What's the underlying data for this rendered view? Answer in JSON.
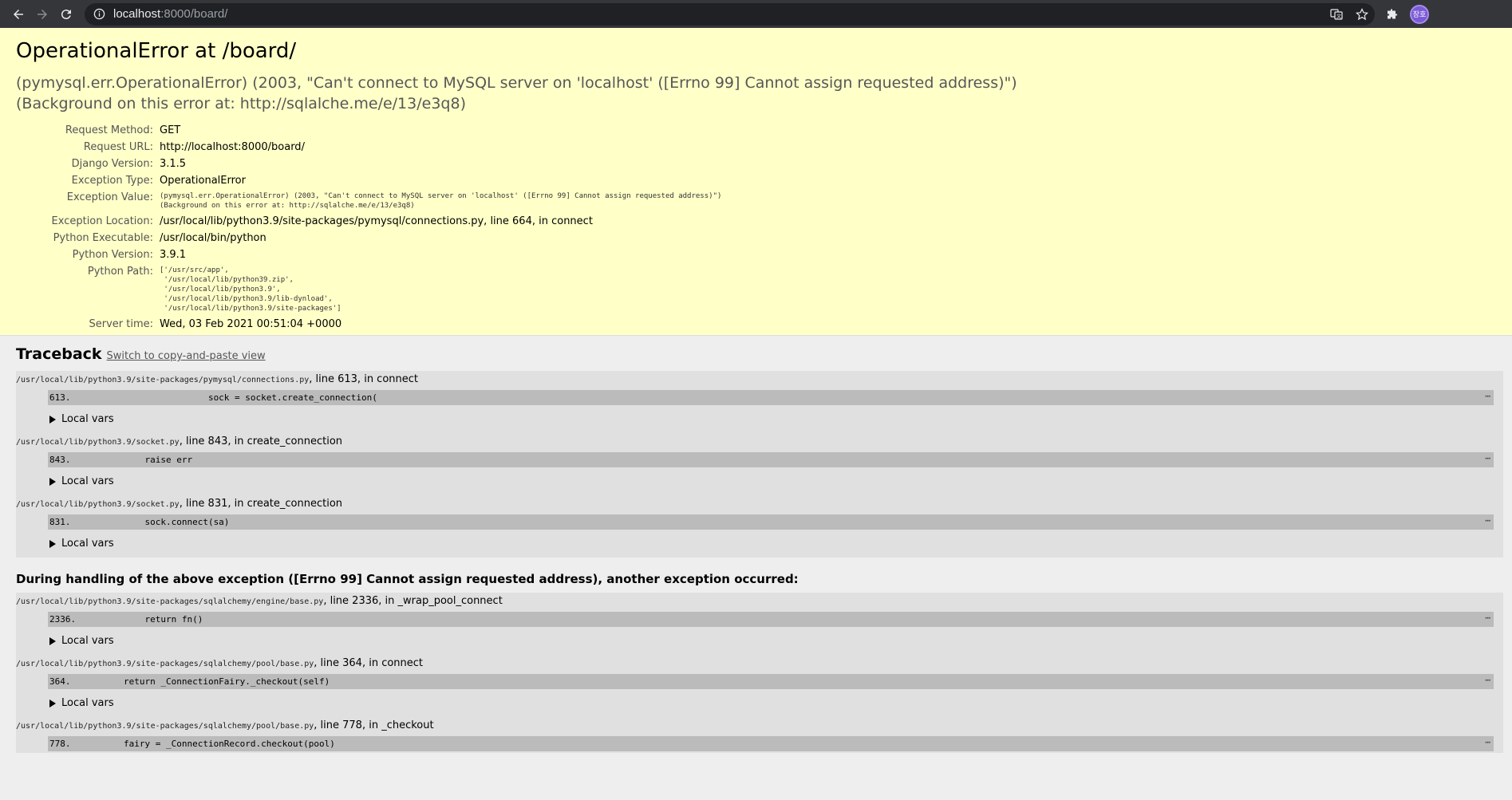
{
  "browser": {
    "url_host": "localhost",
    "url_rest": ":8000/board/",
    "avatar_text": "장호"
  },
  "summary": {
    "title": "OperationalError at /board/",
    "exception_value_line1": "(pymysql.err.OperationalError) (2003, \"Can't connect to MySQL server on 'localhost' ([Errno 99] Cannot assign requested address)\")",
    "exception_value_line2": "(Background on this error at: http://sqlalche.me/e/13/e3q8)",
    "meta": {
      "request_method_label": "Request Method:",
      "request_method": "GET",
      "request_url_label": "Request URL:",
      "request_url": "http://localhost:8000/board/",
      "django_version_label": "Django Version:",
      "django_version": "3.1.5",
      "exception_type_label": "Exception Type:",
      "exception_type": "OperationalError",
      "exception_value_label": "Exception Value:",
      "exception_value_1": "(pymysql.err.OperationalError) (2003, \"Can't connect to MySQL server on 'localhost' ([Errno 99] Cannot assign requested address)\")",
      "exception_value_2": "(Background on this error at: http://sqlalche.me/e/13/e3q8)",
      "exception_location_label": "Exception Location:",
      "exception_location": "/usr/local/lib/python3.9/site-packages/pymysql/connections.py, line 664, in connect",
      "python_executable_label": "Python Executable:",
      "python_executable": "/usr/local/bin/python",
      "python_version_label": "Python Version:",
      "python_version": "3.9.1",
      "python_path_label": "Python Path:",
      "python_path": [
        "['/usr/src/app',",
        " '/usr/local/lib/python39.zip',",
        " '/usr/local/lib/python3.9',",
        " '/usr/local/lib/python3.9/lib-dynload',",
        " '/usr/local/lib/python3.9/site-packages']"
      ],
      "server_time_label": "Server time:",
      "server_time": "Wed, 03 Feb 2021 00:51:04 +0000"
    }
  },
  "traceback": {
    "title": "Traceback",
    "switch_label": "Switch to copy-and-paste view",
    "local_vars_label": "Local vars",
    "group1": [
      {
        "file": "/usr/local/lib/python3.9/site-packages/pymysql/connections.py",
        "where": ", line 613, in connect",
        "lineno": "613.",
        "code": "                        sock = socket.create_connection("
      },
      {
        "file": "/usr/local/lib/python3.9/socket.py",
        "where": ", line 843, in create_connection",
        "lineno": "843.",
        "code": "            raise err"
      },
      {
        "file": "/usr/local/lib/python3.9/socket.py",
        "where": ", line 831, in create_connection",
        "lineno": "831.",
        "code": "            sock.connect(sa)"
      }
    ],
    "during_text": "During handling of the above exception ([Errno 99] Cannot assign requested address), another exception occurred:",
    "group2": [
      {
        "file": "/usr/local/lib/python3.9/site-packages/sqlalchemy/engine/base.py",
        "where": ", line 2336, in _wrap_pool_connect",
        "lineno": "2336.",
        "code": "            return fn()"
      },
      {
        "file": "/usr/local/lib/python3.9/site-packages/sqlalchemy/pool/base.py",
        "where": ", line 364, in connect",
        "lineno": "364.",
        "code": "        return _ConnectionFairy._checkout(self)"
      },
      {
        "file": "/usr/local/lib/python3.9/site-packages/sqlalchemy/pool/base.py",
        "where": ", line 778, in _checkout",
        "lineno": "778.",
        "code": "        fairy = _ConnectionRecord.checkout(pool)"
      }
    ],
    "dots": "⋯"
  }
}
